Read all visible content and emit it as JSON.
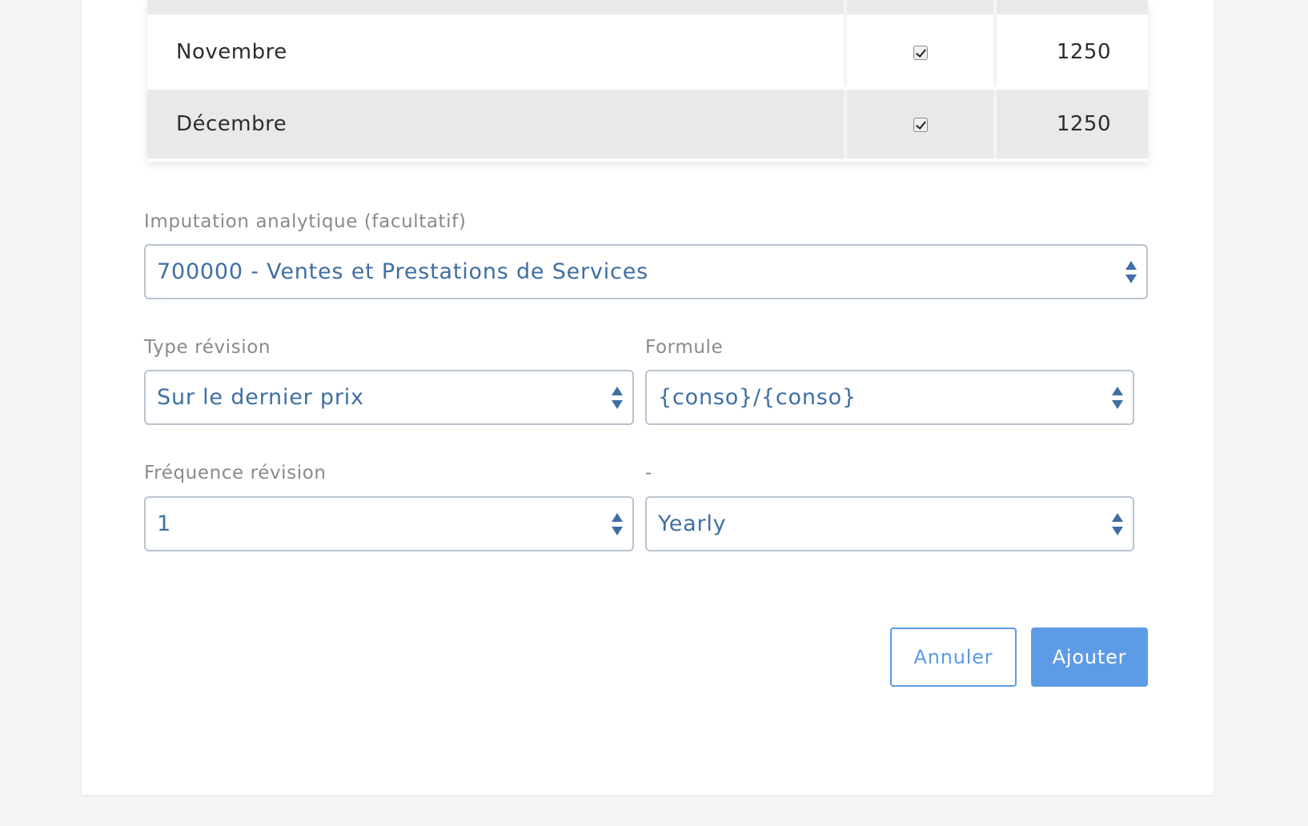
{
  "table": {
    "rows": [
      {
        "month": "",
        "checked": true,
        "amount": ""
      },
      {
        "month": "Novembre",
        "checked": true,
        "amount": "1250"
      },
      {
        "month": "Décembre",
        "checked": true,
        "amount": "1250"
      }
    ]
  },
  "form": {
    "imputation": {
      "label": "Imputation analytique (facultatif)",
      "value": "700000 - Ventes et Prestations de Services"
    },
    "type_revision": {
      "label": "Type révision",
      "value": "Sur le dernier prix"
    },
    "formule": {
      "label": "Formule",
      "value": "{conso}/{conso}"
    },
    "frequence_revision": {
      "label": "Fréquence révision",
      "value": "1"
    },
    "frequence_unit": {
      "label": "-",
      "value": "Yearly"
    }
  },
  "actions": {
    "cancel_label": "Annuler",
    "add_label": "Ajouter"
  },
  "colors": {
    "accent": "#5d9be6",
    "select_text": "#3f6ea3",
    "row_shade": "#e9e9e9"
  }
}
